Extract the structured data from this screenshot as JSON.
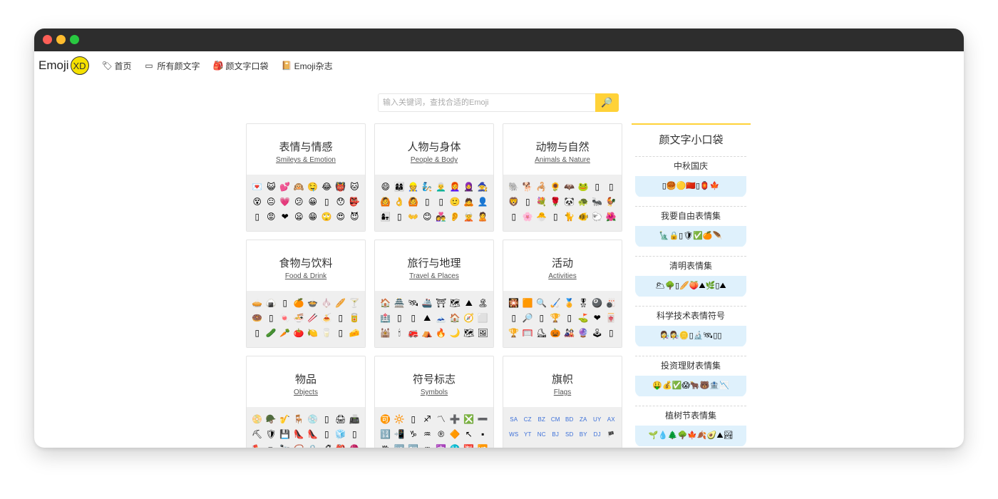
{
  "colors": {
    "accent": "#ffd238",
    "titlebar": "#2d2d2d",
    "pocket_bg": "#dff1fc"
  },
  "nav": {
    "logo_text": "Emoji",
    "logo_badge": "XD",
    "items": [
      {
        "icon": "tag-icon",
        "glyph": "🏷",
        "label": "首页"
      },
      {
        "icon": "square-icon",
        "glyph": "▭",
        "label": "所有颜文字"
      },
      {
        "icon": "backpack-icon",
        "glyph": "🎒",
        "label": "颜文字口袋"
      },
      {
        "icon": "book-icon",
        "glyph": "📔",
        "label": "Emoji杂志"
      }
    ]
  },
  "search": {
    "placeholder": "输入关键词，查找合适的Emoji",
    "button_icon": "🔎"
  },
  "categories": [
    {
      "title": "表情与情感",
      "subtitle": "Smileys & Emotion",
      "emojis": [
        "💌",
        "😺",
        "💕",
        "🙉",
        "🤤",
        "😂",
        "👹",
        "🐱",
        "😵",
        "😐",
        "💗",
        "😕",
        "😀",
        "▯",
        "😯",
        "👺",
        "▯",
        "😡",
        "❤",
        "😦",
        "😁",
        "🙄",
        "😍",
        "😈"
      ]
    },
    {
      "title": "人物与身体",
      "subtitle": "People & Body",
      "emojis": [
        "😄",
        "👩‍👩‍👦",
        "👷",
        "🧞",
        "👨‍🦳",
        "👩‍🦰",
        "🧕",
        "🧙",
        "🙆",
        "👌",
        "🙆",
        "▯",
        "▯",
        "🙂",
        "🙇",
        "👤",
        "👩‍👧",
        "▯",
        "👐",
        "😊",
        "👩‍❤️‍👨",
        "👂",
        "🧝",
        "🙎"
      ]
    },
    {
      "title": "动物与自然",
      "subtitle": "Animals & Nature",
      "emojis": [
        "🐘",
        "🐕",
        "🦂",
        "🌻",
        "🦇",
        "🐸",
        "▯",
        "▯",
        "🦁",
        "▯",
        "💐",
        "🌹",
        "🐼",
        "🐢",
        "🐜",
        "🐓",
        "▯",
        "🌸",
        "🐣",
        "▯",
        "🐈",
        "🐠",
        "🐑",
        "🌺"
      ]
    },
    {
      "title": "食物与饮料",
      "subtitle": "Food & Drink",
      "emojis": [
        "🥧",
        "🍙",
        "▯",
        "🍊",
        "🍲",
        "🧄",
        "🥖",
        "🍸",
        "🍩",
        "▯",
        "🍬",
        "🍜",
        "🥢",
        "🍝",
        "▯",
        "🥫",
        "▯",
        "🥒",
        "🥕",
        "🍅",
        "🍋",
        "🥛",
        "▯",
        "🧀"
      ]
    },
    {
      "title": "旅行与地理",
      "subtitle": "Travel & Places",
      "emojis": [
        "🏠",
        "🏯",
        "🛰",
        "🚢",
        "⛩",
        "🗺",
        "⛰",
        "🏝",
        "🏥",
        "▯",
        "▯",
        "⛰",
        "🗻",
        "🏠",
        "🧭",
        "⬜",
        "🕍",
        "🕯",
        "🚒",
        "⛺",
        "🔥",
        "🌙",
        "🗺",
        "🖼"
      ]
    },
    {
      "title": "活动",
      "subtitle": "Activities",
      "emojis": [
        "🎇",
        "🟧",
        "🔍",
        "🏑",
        "🏅",
        "🎖",
        "🎱",
        "🎳",
        "▯",
        "🔎",
        "▯",
        "🏆",
        "▯",
        "⛳",
        "❤",
        "🀄",
        "🏆",
        "🥅",
        "⛸",
        "🎃",
        "🎎",
        "🔮",
        "🕹",
        "▯"
      ]
    },
    {
      "title": "物品",
      "subtitle": "Objects",
      "emojis": [
        "📀",
        "🪖",
        "🎷",
        "🪑",
        "💿",
        "▯",
        "🖨",
        "📠",
        "⛏",
        "🛡",
        "💾",
        "👠",
        "👠",
        "▯",
        "🧊",
        "▯",
        "🪓",
        "✏",
        "🔭",
        "📿",
        "🔒",
        "🖋",
        "🎒",
        "🧶"
      ]
    },
    {
      "title": "符号标志",
      "subtitle": "Symbols",
      "emojis": [
        "🉑",
        "🔆",
        "▯",
        "♐",
        "〽",
        "➕",
        "❎",
        "➖",
        "🔢",
        "📲",
        "♑",
        "♒",
        "®",
        "🔶",
        "↖",
        "▪",
        "♍",
        "🆖",
        "🆗",
        "♒",
        "🔯",
        "⛎",
        "🈹",
        "🆚"
      ]
    },
    {
      "title": "旗帜",
      "subtitle": "Flags",
      "flags": true,
      "emojis": [
        "SA",
        "CZ",
        "BZ",
        "CM",
        "BD",
        "ZA",
        "UY",
        "AX",
        "WS",
        "YT",
        "NC",
        "BJ",
        "SD",
        "BY",
        "DJ",
        "🏴"
      ]
    }
  ],
  "sidebar": {
    "title": "颜文字小口袋",
    "pockets": [
      {
        "title": "中秋国庆",
        "emojis": "▯🥮🟡🇨🇳▯🏮🍁"
      },
      {
        "title": "我要自由表情集",
        "emojis": "🗽🔒▯🛡✅🍊🪶"
      },
      {
        "title": "清明表情集",
        "emojis": "🌥🌳▯🥖🍑⛰🌿▯⛰"
      },
      {
        "title": "科学技术表情符号",
        "emojis": "👩‍🔬👩‍🔬🪙▯🔬🛰▯▯"
      },
      {
        "title": "投资理财表情集",
        "emojis": "🤑💰✅😱🐂🐻🏦📉"
      },
      {
        "title": "植树节表情集",
        "emojis": "🌱💧🌲🌳🍁🍂🥑⛰🏞"
      }
    ]
  }
}
